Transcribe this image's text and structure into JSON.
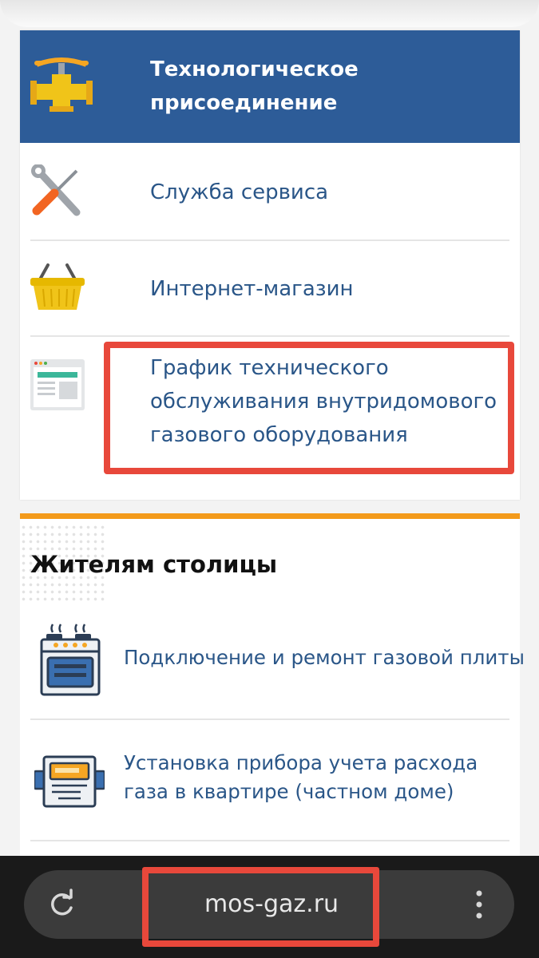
{
  "menu": {
    "items": [
      {
        "label": "Технологическое присоединение",
        "icon": "valve-pipe-icon",
        "active": true
      },
      {
        "label": "Служба сервиса",
        "icon": "wrench-screwdriver-icon"
      },
      {
        "label": "Интернет-магазин",
        "icon": "shopping-basket-icon"
      },
      {
        "label": "График технического обслуживания внутридомового газового оборудования",
        "icon": "schedule-document-icon"
      }
    ]
  },
  "residents": {
    "title": "Жителям столицы",
    "items": [
      {
        "label": "Подключение и ремонт газовой плиты",
        "icon": "gas-stove-icon"
      },
      {
        "label": "Установка прибора учета расхода газа в квартире (частном доме)",
        "icon": "gas-meter-icon"
      }
    ]
  },
  "browser": {
    "url": "mos-gaz.ru",
    "reload_icon": "reload-icon",
    "menu_icon": "more-vert-icon"
  },
  "colors": {
    "active_bg": "#2d5c98",
    "link": "#2a5688",
    "accent": "#f39a1b",
    "highlight": "#e8483b"
  }
}
